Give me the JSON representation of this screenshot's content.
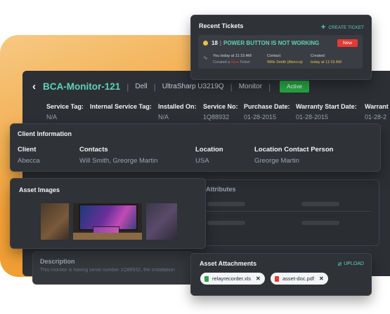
{
  "colors": {
    "accent": "#5ed3b8",
    "active": "#27a844",
    "new_badge": "#e53935",
    "background_orange": "#f2a23a"
  },
  "header": {
    "asset_name": "BCA-Monitor-121",
    "manufacturer": "Dell",
    "model": "UltraSharp U3219Q",
    "type": "Monitor",
    "status": "Active"
  },
  "details": [
    {
      "label": "Service Tag:",
      "value": "N/A"
    },
    {
      "label": "Internal Service Tag:",
      "value": ""
    },
    {
      "label": "Installed On:",
      "value": "N/A"
    },
    {
      "label": "Service No:",
      "value": "1Q88932"
    },
    {
      "label": "Purchase Date:",
      "value": "01-28-2015"
    },
    {
      "label": "Warranty Start Date:",
      "value": "01-28-2015"
    },
    {
      "label": "Warrant",
      "value": "01-28-2"
    }
  ],
  "client_info": {
    "title": "Client Information",
    "client_label": "Client",
    "client": "Abecca",
    "contacts_label": "Contacts",
    "contacts": "Will Smith, Greorge Martin",
    "location_label": "Location",
    "location": "USA",
    "location_contact_label": "Location Contact Person",
    "location_contact": "Greorge Martin"
  },
  "asset_images": {
    "title": "Asset Images"
  },
  "attributes": {
    "title": "Attributes"
  },
  "description": {
    "title": "Description",
    "text": "This monitor is having serial number 1Q88932, the installation"
  },
  "recent_tickets": {
    "title": "Recent Tickets",
    "create_label": "CREATE TICKET",
    "ticket": {
      "number": "18",
      "subject": "POWER BUTTON IS NOT WORKING",
      "badge": "New",
      "activity_who": "You today at 11:15 AM",
      "activity_prefix": "Created a",
      "activity_new": "New",
      "activity_suffix": "Ticket",
      "contact_label": "Contact:",
      "contact": "Wills Smith (Abecca)",
      "created_label": "Created:",
      "created": "today at 11:15 AM"
    }
  },
  "attachments": {
    "title": "Asset Attachments",
    "upload_label": "UPLOAD",
    "files": [
      {
        "name": "relayrecorder.xls",
        "icon": "spreadsheet-icon"
      },
      {
        "name": "asset-doc.pdf",
        "icon": "pdf-icon"
      }
    ]
  }
}
